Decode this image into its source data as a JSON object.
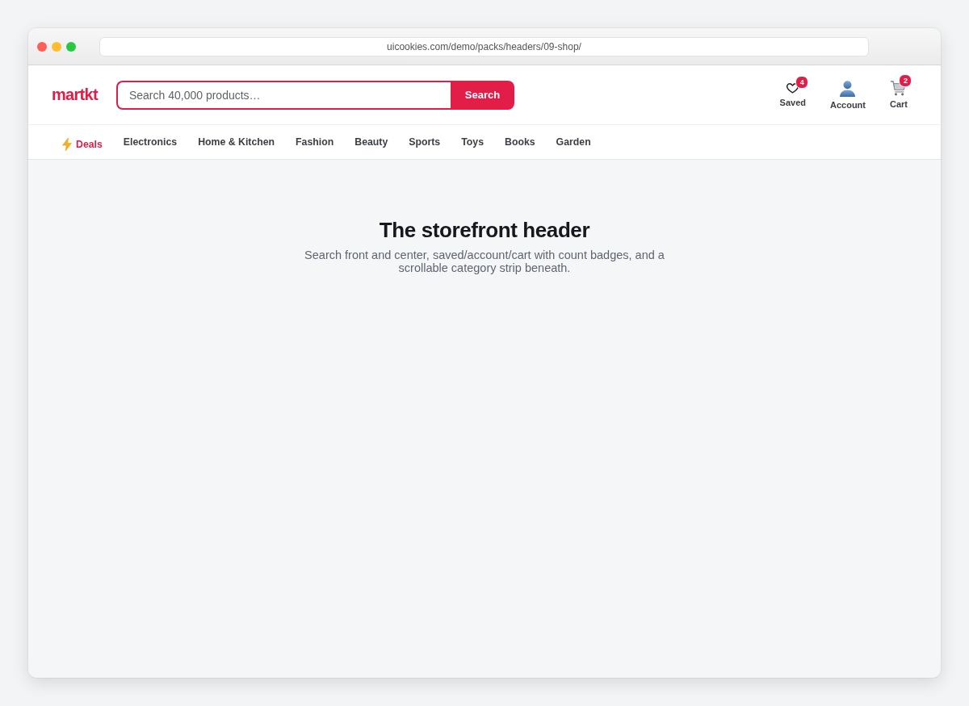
{
  "browser": {
    "url": "uicookies.com/demo/packs/headers/09-shop/"
  },
  "header": {
    "logo": "martkt",
    "search": {
      "placeholder": "Search 40,000 products…",
      "button": "Search"
    },
    "actions": [
      {
        "kind": "saved",
        "label": "Saved",
        "badge": "4"
      },
      {
        "kind": "account",
        "label": "Account"
      },
      {
        "kind": "cart",
        "label": "Cart",
        "badge": "2"
      }
    ]
  },
  "categories": [
    {
      "kind": "deal",
      "label": "Deals"
    },
    {
      "kind": "category",
      "label": "Electronics"
    },
    {
      "kind": "category",
      "label": "Home & Kitchen"
    },
    {
      "kind": "category",
      "label": "Fashion"
    },
    {
      "kind": "category",
      "label": "Beauty"
    },
    {
      "kind": "category",
      "label": "Sports"
    },
    {
      "kind": "category",
      "label": "Toys"
    },
    {
      "kind": "category",
      "label": "Books"
    },
    {
      "kind": "category",
      "label": "Garden"
    }
  ],
  "hero": {
    "title": "The storefront header",
    "subtitle": "Search front and center, saved/account/cart with count badges, and a scrollable category strip beneath."
  }
}
